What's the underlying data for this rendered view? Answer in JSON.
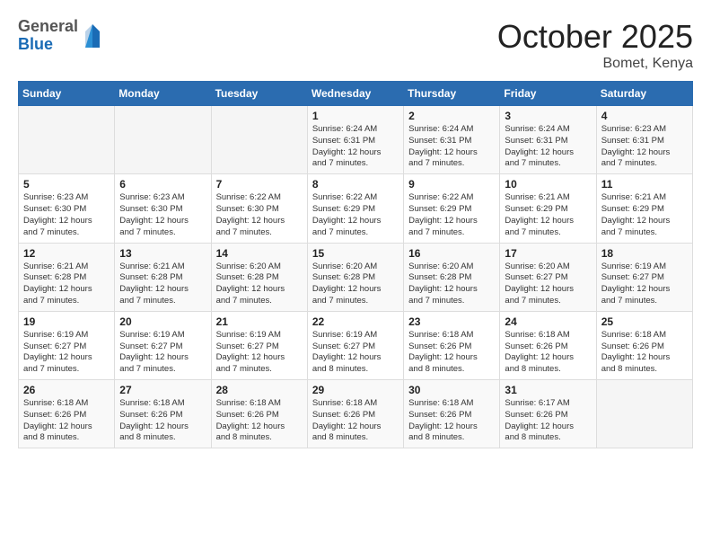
{
  "logo": {
    "general": "General",
    "blue": "Blue"
  },
  "title": "October 2025",
  "location": "Bomet, Kenya",
  "days_header": [
    "Sunday",
    "Monday",
    "Tuesday",
    "Wednesday",
    "Thursday",
    "Friday",
    "Saturday"
  ],
  "weeks": [
    [
      {
        "day": "",
        "info": ""
      },
      {
        "day": "",
        "info": ""
      },
      {
        "day": "",
        "info": ""
      },
      {
        "day": "1",
        "info": "Sunrise: 6:24 AM\nSunset: 6:31 PM\nDaylight: 12 hours\nand 7 minutes."
      },
      {
        "day": "2",
        "info": "Sunrise: 6:24 AM\nSunset: 6:31 PM\nDaylight: 12 hours\nand 7 minutes."
      },
      {
        "day": "3",
        "info": "Sunrise: 6:24 AM\nSunset: 6:31 PM\nDaylight: 12 hours\nand 7 minutes."
      },
      {
        "day": "4",
        "info": "Sunrise: 6:23 AM\nSunset: 6:31 PM\nDaylight: 12 hours\nand 7 minutes."
      }
    ],
    [
      {
        "day": "5",
        "info": "Sunrise: 6:23 AM\nSunset: 6:30 PM\nDaylight: 12 hours\nand 7 minutes."
      },
      {
        "day": "6",
        "info": "Sunrise: 6:23 AM\nSunset: 6:30 PM\nDaylight: 12 hours\nand 7 minutes."
      },
      {
        "day": "7",
        "info": "Sunrise: 6:22 AM\nSunset: 6:30 PM\nDaylight: 12 hours\nand 7 minutes."
      },
      {
        "day": "8",
        "info": "Sunrise: 6:22 AM\nSunset: 6:29 PM\nDaylight: 12 hours\nand 7 minutes."
      },
      {
        "day": "9",
        "info": "Sunrise: 6:22 AM\nSunset: 6:29 PM\nDaylight: 12 hours\nand 7 minutes."
      },
      {
        "day": "10",
        "info": "Sunrise: 6:21 AM\nSunset: 6:29 PM\nDaylight: 12 hours\nand 7 minutes."
      },
      {
        "day": "11",
        "info": "Sunrise: 6:21 AM\nSunset: 6:29 PM\nDaylight: 12 hours\nand 7 minutes."
      }
    ],
    [
      {
        "day": "12",
        "info": "Sunrise: 6:21 AM\nSunset: 6:28 PM\nDaylight: 12 hours\nand 7 minutes."
      },
      {
        "day": "13",
        "info": "Sunrise: 6:21 AM\nSunset: 6:28 PM\nDaylight: 12 hours\nand 7 minutes."
      },
      {
        "day": "14",
        "info": "Sunrise: 6:20 AM\nSunset: 6:28 PM\nDaylight: 12 hours\nand 7 minutes."
      },
      {
        "day": "15",
        "info": "Sunrise: 6:20 AM\nSunset: 6:28 PM\nDaylight: 12 hours\nand 7 minutes."
      },
      {
        "day": "16",
        "info": "Sunrise: 6:20 AM\nSunset: 6:28 PM\nDaylight: 12 hours\nand 7 minutes."
      },
      {
        "day": "17",
        "info": "Sunrise: 6:20 AM\nSunset: 6:27 PM\nDaylight: 12 hours\nand 7 minutes."
      },
      {
        "day": "18",
        "info": "Sunrise: 6:19 AM\nSunset: 6:27 PM\nDaylight: 12 hours\nand 7 minutes."
      }
    ],
    [
      {
        "day": "19",
        "info": "Sunrise: 6:19 AM\nSunset: 6:27 PM\nDaylight: 12 hours\nand 7 minutes."
      },
      {
        "day": "20",
        "info": "Sunrise: 6:19 AM\nSunset: 6:27 PM\nDaylight: 12 hours\nand 7 minutes."
      },
      {
        "day": "21",
        "info": "Sunrise: 6:19 AM\nSunset: 6:27 PM\nDaylight: 12 hours\nand 7 minutes."
      },
      {
        "day": "22",
        "info": "Sunrise: 6:19 AM\nSunset: 6:27 PM\nDaylight: 12 hours\nand 8 minutes."
      },
      {
        "day": "23",
        "info": "Sunrise: 6:18 AM\nSunset: 6:26 PM\nDaylight: 12 hours\nand 8 minutes."
      },
      {
        "day": "24",
        "info": "Sunrise: 6:18 AM\nSunset: 6:26 PM\nDaylight: 12 hours\nand 8 minutes."
      },
      {
        "day": "25",
        "info": "Sunrise: 6:18 AM\nSunset: 6:26 PM\nDaylight: 12 hours\nand 8 minutes."
      }
    ],
    [
      {
        "day": "26",
        "info": "Sunrise: 6:18 AM\nSunset: 6:26 PM\nDaylight: 12 hours\nand 8 minutes."
      },
      {
        "day": "27",
        "info": "Sunrise: 6:18 AM\nSunset: 6:26 PM\nDaylight: 12 hours\nand 8 minutes."
      },
      {
        "day": "28",
        "info": "Sunrise: 6:18 AM\nSunset: 6:26 PM\nDaylight: 12 hours\nand 8 minutes."
      },
      {
        "day": "29",
        "info": "Sunrise: 6:18 AM\nSunset: 6:26 PM\nDaylight: 12 hours\nand 8 minutes."
      },
      {
        "day": "30",
        "info": "Sunrise: 6:18 AM\nSunset: 6:26 PM\nDaylight: 12 hours\nand 8 minutes."
      },
      {
        "day": "31",
        "info": "Sunrise: 6:17 AM\nSunset: 6:26 PM\nDaylight: 12 hours\nand 8 minutes."
      },
      {
        "day": "",
        "info": ""
      }
    ]
  ]
}
